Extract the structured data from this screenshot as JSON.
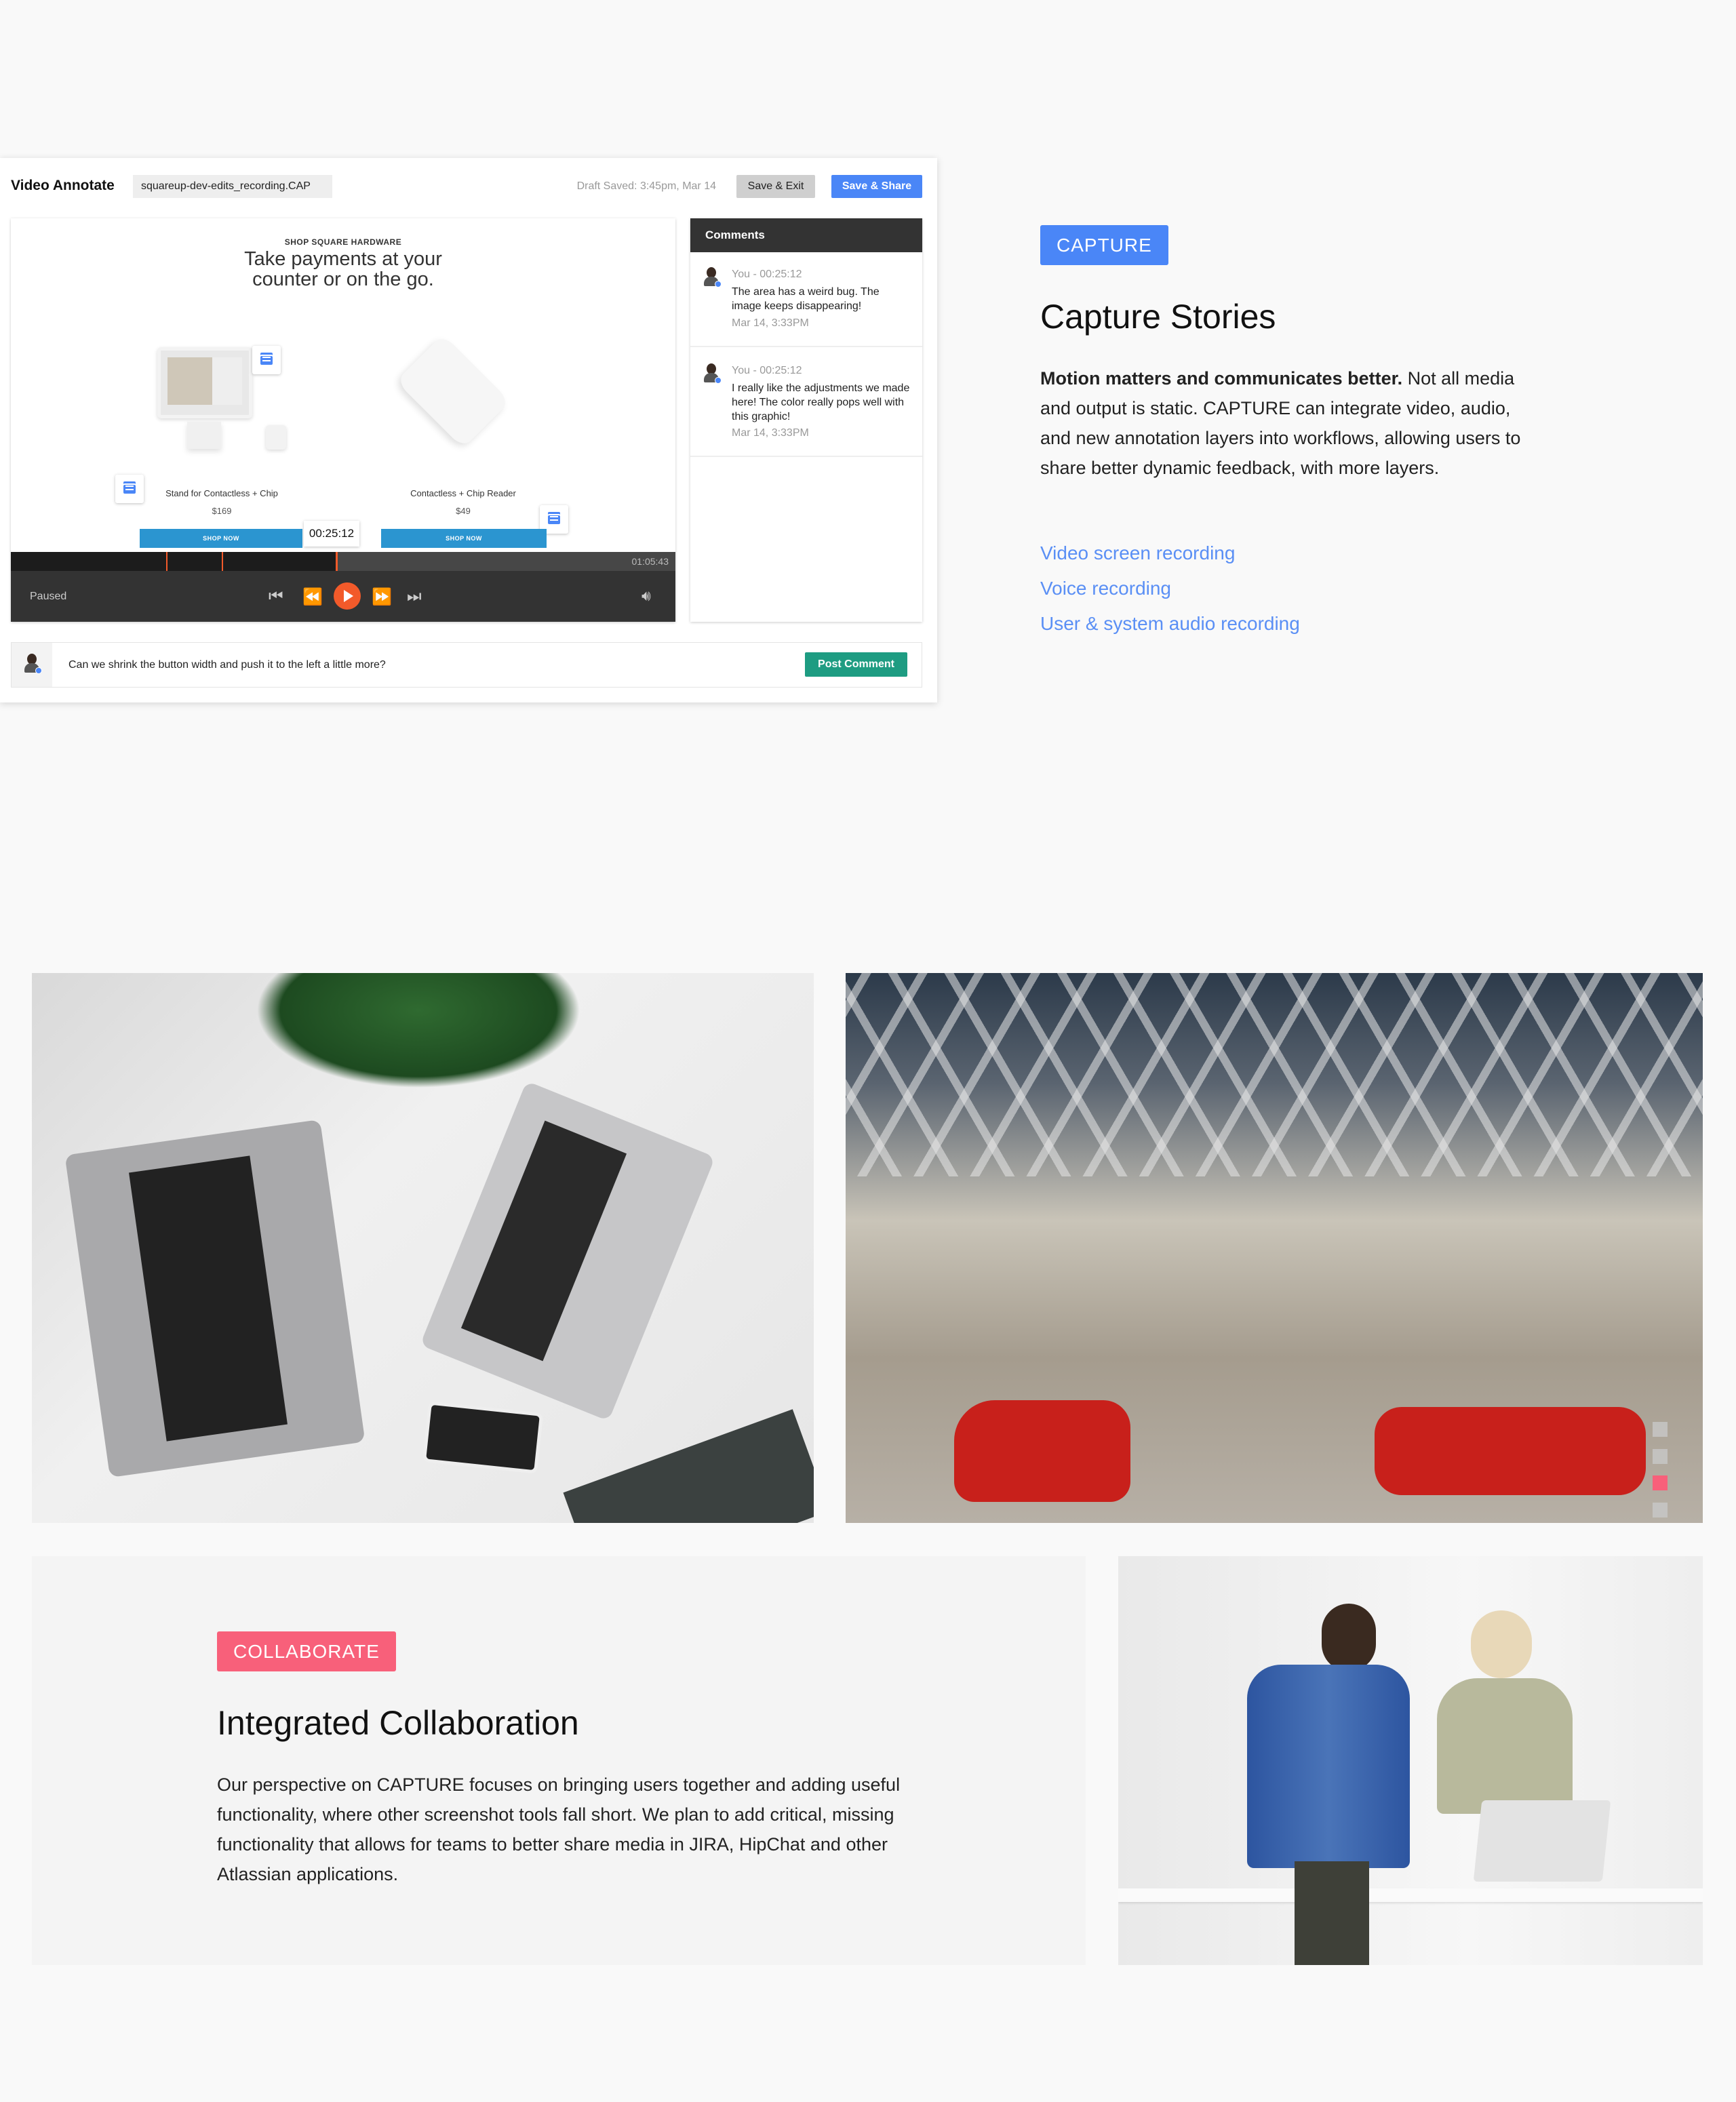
{
  "app": {
    "title": "Video Annotate",
    "filename": "squareup-dev-edits_recording.CAP",
    "draft_status": "Draft Saved: 3:45pm, Mar 14",
    "save_exit_label": "Save & Exit",
    "save_share_label": "Save & Share",
    "accent": "#4a86f7"
  },
  "video": {
    "eyebrow": "SHOP SQUARE HARDWARE",
    "headline_1": "Take payments at your",
    "headline_2": "counter or on the go.",
    "products": [
      {
        "name": "Stand for Contactless + Chip",
        "price": "$169",
        "cta": "SHOP NOW"
      },
      {
        "name": "Contactless + Chip Reader",
        "price": "$49",
        "cta": "SHOP NOW"
      }
    ],
    "tooltip_time": "00:25:12",
    "duration": "01:05:43",
    "status": "Paused",
    "progress_fraction": 0.49,
    "playhead_color": "#f25a2a"
  },
  "comments": {
    "title": "Comments",
    "items": [
      {
        "meta": "You - 00:25:12",
        "body": "The area has a weird bug. The image keeps disappearing!",
        "date": "Mar 14, 3:33PM"
      },
      {
        "meta": "You - 00:25:12",
        "body": "I really like the adjustments we made here! The color really pops well with this graphic!",
        "date": "Mar 14, 3:33PM"
      }
    ],
    "input_value": "Can we shrink the button width and push it to the left a little more?",
    "post_label": "Post Comment",
    "post_color": "#1e9c82"
  },
  "capture": {
    "badge": "CAPTURE",
    "badge_color": "#4a86f7",
    "title": "Capture Stories",
    "lead": "Motion matters and communicates better.",
    "body": " Not all media and output is static. CAPTURE can integrate video, audio, and new annotation layers into workflows, allowing users to share better dynamic feedback, with more layers.",
    "links": [
      "Video screen recording",
      "Voice recording",
      "User & system audio recording"
    ]
  },
  "collaborate": {
    "badge": "COLLABORATE",
    "badge_color": "#f8607a",
    "title": "Integrated Collaboration",
    "body": "Our perspective on CAPTURE focuses on bringing users together and adding useful functionality, where other screenshot tools fall short. We plan to add critical, missing functionality that allows for teams to better share media in JIRA, HipChat and other Atlassian applications."
  },
  "carousel": {
    "count": 4,
    "active_index": 2,
    "active_color": "#f8607a"
  }
}
